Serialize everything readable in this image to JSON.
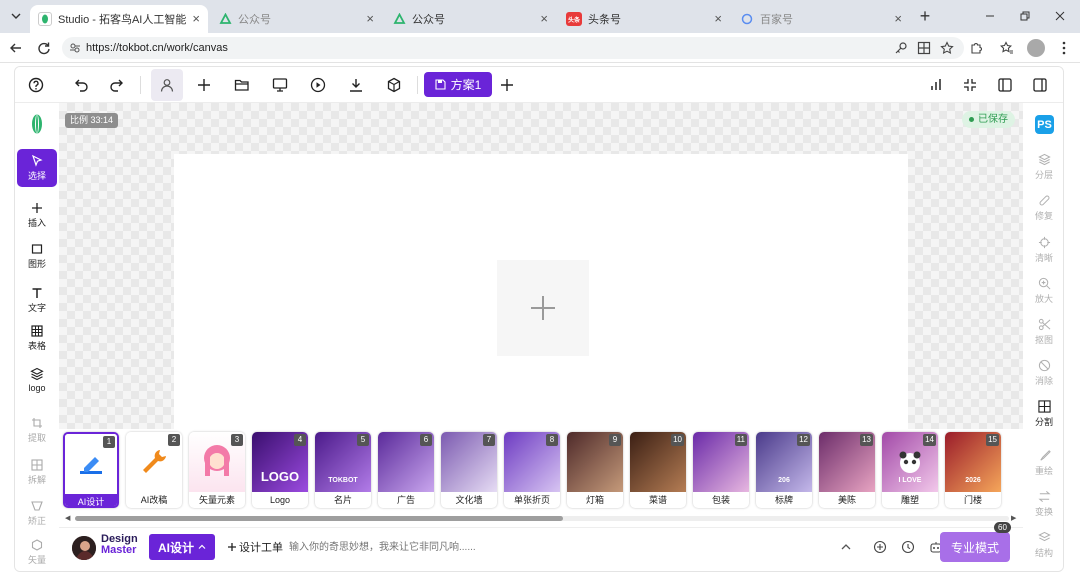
{
  "browser": {
    "tabs": [
      {
        "title": "Studio - 拓客鸟AI人工智能"
      },
      {
        "title": "公众号"
      },
      {
        "title": "公众号"
      },
      {
        "title": "头条号"
      },
      {
        "title": "百家号"
      }
    ],
    "favicon_toutiao": "头条",
    "url": "https://tokbot.cn/work/canvas"
  },
  "toolbar": {
    "scheme_label": "方案1"
  },
  "left_tools": [
    {
      "label": "选择",
      "icon": "cursor-icon"
    },
    {
      "label": "插入",
      "icon": "plus-icon"
    },
    {
      "label": "图形",
      "icon": "rectangle-icon"
    },
    {
      "label": "文字",
      "icon": "text-icon"
    },
    {
      "label": "表格",
      "icon": "table-icon"
    },
    {
      "label": "logo",
      "icon": "layers-icon"
    },
    {
      "label": "提取",
      "icon": "crop-icon"
    },
    {
      "label": "拆解",
      "icon": "grid-icon"
    },
    {
      "label": "矫正",
      "icon": "perspective-icon"
    },
    {
      "label": "矢量",
      "icon": "hexagon-icon"
    }
  ],
  "right_tools": [
    {
      "label": "分层",
      "icon": "layers-icon"
    },
    {
      "label": "修复",
      "icon": "bandage-icon"
    },
    {
      "label": "清晰",
      "icon": "focus-icon"
    },
    {
      "label": "放大",
      "icon": "zoom-icon"
    },
    {
      "label": "抠图",
      "icon": "scissors-icon"
    },
    {
      "label": "消除",
      "icon": "eraser-icon"
    },
    {
      "label": "分割",
      "icon": "split-icon"
    },
    {
      "label": "重绘",
      "icon": "brush-icon"
    },
    {
      "label": "变换",
      "icon": "swap-icon"
    },
    {
      "label": "结构",
      "icon": "structure-icon"
    }
  ],
  "ps_badge": "PS",
  "canvas": {
    "ratio_label": "比例 33:14",
    "saved_label": "已保存"
  },
  "templates": [
    {
      "num": "1",
      "label": "AI设计"
    },
    {
      "num": "2",
      "label": "AI改稿"
    },
    {
      "num": "3",
      "label": "矢量元素"
    },
    {
      "num": "4",
      "label": "Logo",
      "img_text": "LOGO"
    },
    {
      "num": "5",
      "label": "名片",
      "img_text": "TOKBOT"
    },
    {
      "num": "6",
      "label": "广告"
    },
    {
      "num": "7",
      "label": "文化墙"
    },
    {
      "num": "8",
      "label": "单张折页"
    },
    {
      "num": "9",
      "label": "灯箱"
    },
    {
      "num": "10",
      "label": "菜谱"
    },
    {
      "num": "11",
      "label": "包装"
    },
    {
      "num": "12",
      "label": "标牌",
      "img_text": "206"
    },
    {
      "num": "13",
      "label": "美陈"
    },
    {
      "num": "14",
      "label": "雕塑",
      "img_text": "I LOVE"
    },
    {
      "num": "15",
      "label": "门楼",
      "img_text": "2026"
    }
  ],
  "bottom": {
    "brand_line1": "Design",
    "brand_line2": "Master",
    "ai_design_label": "AI设计",
    "work_order_label": "设计工单",
    "prompt_placeholder": "输入你的奇思妙想，我来让它非同凡响......",
    "pro_mode_label": "专业模式",
    "count_badge": "60"
  },
  "colors": {
    "accent": "#6a24d8",
    "saved_green": "#2f9c52",
    "pro_button": "#a86fe8"
  }
}
